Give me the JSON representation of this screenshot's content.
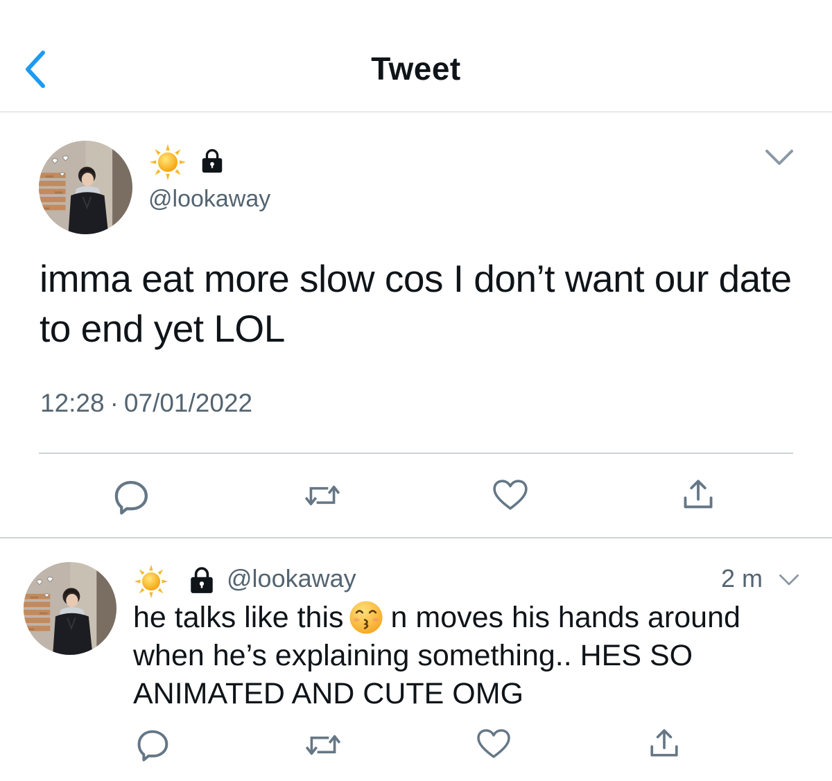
{
  "header": {
    "title": "Tweet",
    "back_icon": "chevron-left-icon"
  },
  "colors": {
    "accent": "#1d9bf0",
    "text": "#0f1419",
    "secondary": "#536471",
    "divider": "#cfd3d6"
  },
  "main_tweet": {
    "handle": "@lookaway",
    "display_icons": [
      "sun-emoji-icon",
      "lock-icon"
    ],
    "text": "imma eat more slow cos I don’t want our date to end yet LOL",
    "time": "12:28",
    "separator": "·",
    "date": "07/01/2022",
    "actions": [
      "reply-icon",
      "retweet-icon",
      "like-icon",
      "share-icon"
    ]
  },
  "reply_tweet": {
    "handle": "@lookaway",
    "time": "2 m",
    "text_before_emoji": "he talks like this",
    "emoji": "kissing-smiling-eyes-emoji",
    "text_after_emoji": "n moves his hands around when he’s explaining something.. HES SO ANIMATED AND CUTE OMG",
    "actions": [
      "reply-icon",
      "retweet-icon",
      "like-icon",
      "share-icon"
    ]
  }
}
